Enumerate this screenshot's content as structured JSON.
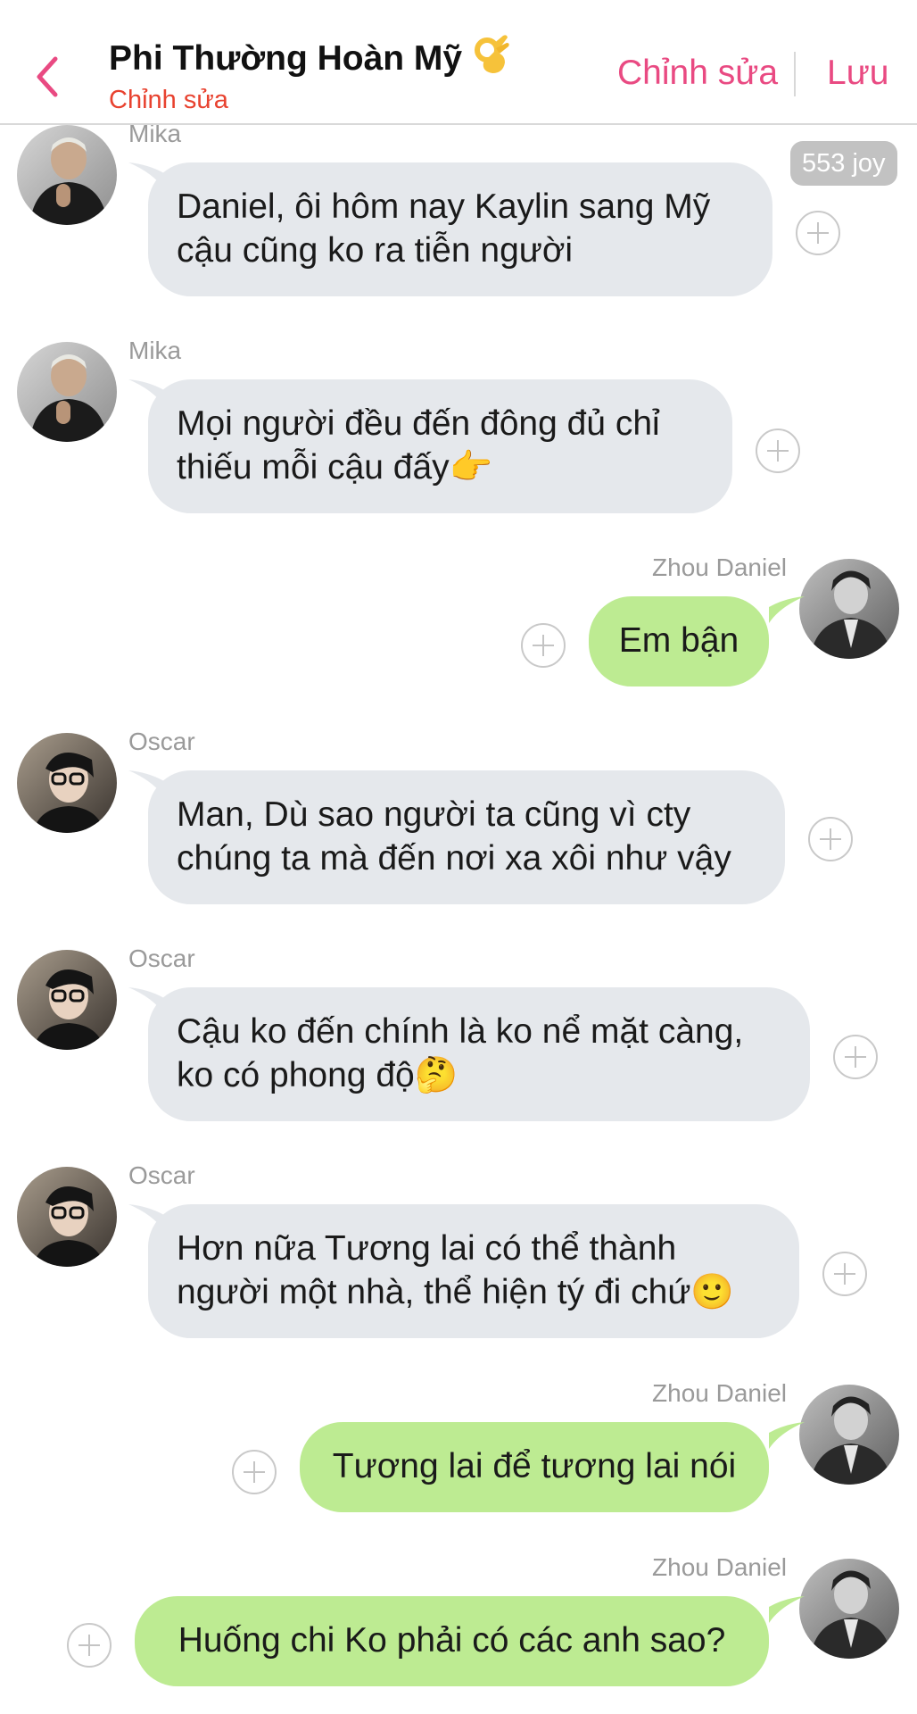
{
  "header": {
    "title": "Phi Thường Hoàn Mỹ",
    "title_emoji": "👌",
    "subtitle": "Chỉnh sửa",
    "edit_label": "Chỉnh sửa",
    "save_label": "Lưu"
  },
  "colors": {
    "accent": "#e94a82",
    "subtitle": "#e8422f",
    "incoming_bubble": "#e5e8ec",
    "outgoing_bubble": "#bdeb92"
  },
  "badge": {
    "label": "553 joy"
  },
  "messages": [
    {
      "sender": "Mika",
      "side": "left",
      "lines": [
        "Daniel, ôi hôm nay Kaylin sang Mỹ",
        "cậu cũng ko ra tiễn người"
      ]
    },
    {
      "sender": "Mika",
      "side": "left",
      "lines": [
        "Mọi người đều đến đông đủ chỉ",
        "thiếu mỗi cậu đấy👉"
      ]
    },
    {
      "sender": "Zhou Daniel",
      "side": "right",
      "lines": [
        "Em bận"
      ]
    },
    {
      "sender": "Oscar",
      "side": "left",
      "lines": [
        "Man, Dù sao người ta cũng vì cty",
        "chúng ta mà đến nơi xa xôi như vậy"
      ]
    },
    {
      "sender": "Oscar",
      "side": "left",
      "lines": [
        "Cậu ko đến chính là ko nể mặt càng,",
        "ko có phong độ🤔"
      ]
    },
    {
      "sender": "Oscar",
      "side": "left",
      "lines": [
        "Hơn nữa Tương lai có thể thành",
        "người một nhà, thể hiện tý đi chứ🙂"
      ]
    },
    {
      "sender": "Zhou Daniel",
      "side": "right",
      "lines": [
        "Tương lai để tương lai nói"
      ]
    },
    {
      "sender": "Zhou Daniel",
      "side": "right",
      "lines": [
        "Huống chi Ko phải có các anh sao?"
      ]
    }
  ]
}
